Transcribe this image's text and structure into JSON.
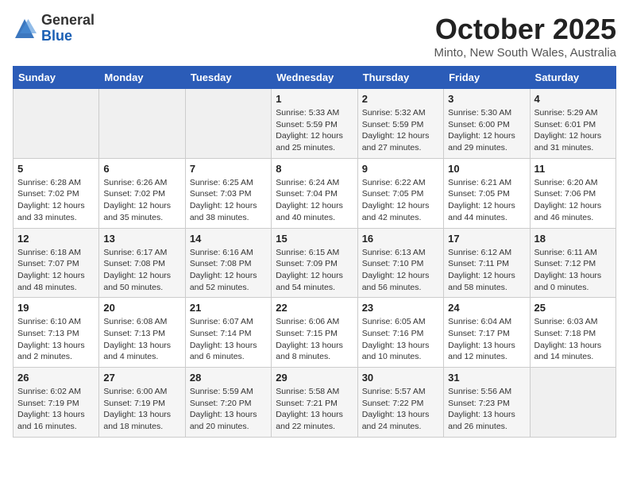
{
  "logo": {
    "general": "General",
    "blue": "Blue"
  },
  "header": {
    "title": "October 2025",
    "subtitle": "Minto, New South Wales, Australia"
  },
  "weekdays": [
    "Sunday",
    "Monday",
    "Tuesday",
    "Wednesday",
    "Thursday",
    "Friday",
    "Saturday"
  ],
  "weeks": [
    [
      {
        "day": "",
        "info": ""
      },
      {
        "day": "",
        "info": ""
      },
      {
        "day": "",
        "info": ""
      },
      {
        "day": "1",
        "info": "Sunrise: 5:33 AM\nSunset: 5:59 PM\nDaylight: 12 hours\nand 25 minutes."
      },
      {
        "day": "2",
        "info": "Sunrise: 5:32 AM\nSunset: 5:59 PM\nDaylight: 12 hours\nand 27 minutes."
      },
      {
        "day": "3",
        "info": "Sunrise: 5:30 AM\nSunset: 6:00 PM\nDaylight: 12 hours\nand 29 minutes."
      },
      {
        "day": "4",
        "info": "Sunrise: 5:29 AM\nSunset: 6:01 PM\nDaylight: 12 hours\nand 31 minutes."
      }
    ],
    [
      {
        "day": "5",
        "info": "Sunrise: 6:28 AM\nSunset: 7:02 PM\nDaylight: 12 hours\nand 33 minutes."
      },
      {
        "day": "6",
        "info": "Sunrise: 6:26 AM\nSunset: 7:02 PM\nDaylight: 12 hours\nand 35 minutes."
      },
      {
        "day": "7",
        "info": "Sunrise: 6:25 AM\nSunset: 7:03 PM\nDaylight: 12 hours\nand 38 minutes."
      },
      {
        "day": "8",
        "info": "Sunrise: 6:24 AM\nSunset: 7:04 PM\nDaylight: 12 hours\nand 40 minutes."
      },
      {
        "day": "9",
        "info": "Sunrise: 6:22 AM\nSunset: 7:05 PM\nDaylight: 12 hours\nand 42 minutes."
      },
      {
        "day": "10",
        "info": "Sunrise: 6:21 AM\nSunset: 7:05 PM\nDaylight: 12 hours\nand 44 minutes."
      },
      {
        "day": "11",
        "info": "Sunrise: 6:20 AM\nSunset: 7:06 PM\nDaylight: 12 hours\nand 46 minutes."
      }
    ],
    [
      {
        "day": "12",
        "info": "Sunrise: 6:18 AM\nSunset: 7:07 PM\nDaylight: 12 hours\nand 48 minutes."
      },
      {
        "day": "13",
        "info": "Sunrise: 6:17 AM\nSunset: 7:08 PM\nDaylight: 12 hours\nand 50 minutes."
      },
      {
        "day": "14",
        "info": "Sunrise: 6:16 AM\nSunset: 7:08 PM\nDaylight: 12 hours\nand 52 minutes."
      },
      {
        "day": "15",
        "info": "Sunrise: 6:15 AM\nSunset: 7:09 PM\nDaylight: 12 hours\nand 54 minutes."
      },
      {
        "day": "16",
        "info": "Sunrise: 6:13 AM\nSunset: 7:10 PM\nDaylight: 12 hours\nand 56 minutes."
      },
      {
        "day": "17",
        "info": "Sunrise: 6:12 AM\nSunset: 7:11 PM\nDaylight: 12 hours\nand 58 minutes."
      },
      {
        "day": "18",
        "info": "Sunrise: 6:11 AM\nSunset: 7:12 PM\nDaylight: 13 hours\nand 0 minutes."
      }
    ],
    [
      {
        "day": "19",
        "info": "Sunrise: 6:10 AM\nSunset: 7:13 PM\nDaylight: 13 hours\nand 2 minutes."
      },
      {
        "day": "20",
        "info": "Sunrise: 6:08 AM\nSunset: 7:13 PM\nDaylight: 13 hours\nand 4 minutes."
      },
      {
        "day": "21",
        "info": "Sunrise: 6:07 AM\nSunset: 7:14 PM\nDaylight: 13 hours\nand 6 minutes."
      },
      {
        "day": "22",
        "info": "Sunrise: 6:06 AM\nSunset: 7:15 PM\nDaylight: 13 hours\nand 8 minutes."
      },
      {
        "day": "23",
        "info": "Sunrise: 6:05 AM\nSunset: 7:16 PM\nDaylight: 13 hours\nand 10 minutes."
      },
      {
        "day": "24",
        "info": "Sunrise: 6:04 AM\nSunset: 7:17 PM\nDaylight: 13 hours\nand 12 minutes."
      },
      {
        "day": "25",
        "info": "Sunrise: 6:03 AM\nSunset: 7:18 PM\nDaylight: 13 hours\nand 14 minutes."
      }
    ],
    [
      {
        "day": "26",
        "info": "Sunrise: 6:02 AM\nSunset: 7:19 PM\nDaylight: 13 hours\nand 16 minutes."
      },
      {
        "day": "27",
        "info": "Sunrise: 6:00 AM\nSunset: 7:19 PM\nDaylight: 13 hours\nand 18 minutes."
      },
      {
        "day": "28",
        "info": "Sunrise: 5:59 AM\nSunset: 7:20 PM\nDaylight: 13 hours\nand 20 minutes."
      },
      {
        "day": "29",
        "info": "Sunrise: 5:58 AM\nSunset: 7:21 PM\nDaylight: 13 hours\nand 22 minutes."
      },
      {
        "day": "30",
        "info": "Sunrise: 5:57 AM\nSunset: 7:22 PM\nDaylight: 13 hours\nand 24 minutes."
      },
      {
        "day": "31",
        "info": "Sunrise: 5:56 AM\nSunset: 7:23 PM\nDaylight: 13 hours\nand 26 minutes."
      },
      {
        "day": "",
        "info": ""
      }
    ]
  ]
}
